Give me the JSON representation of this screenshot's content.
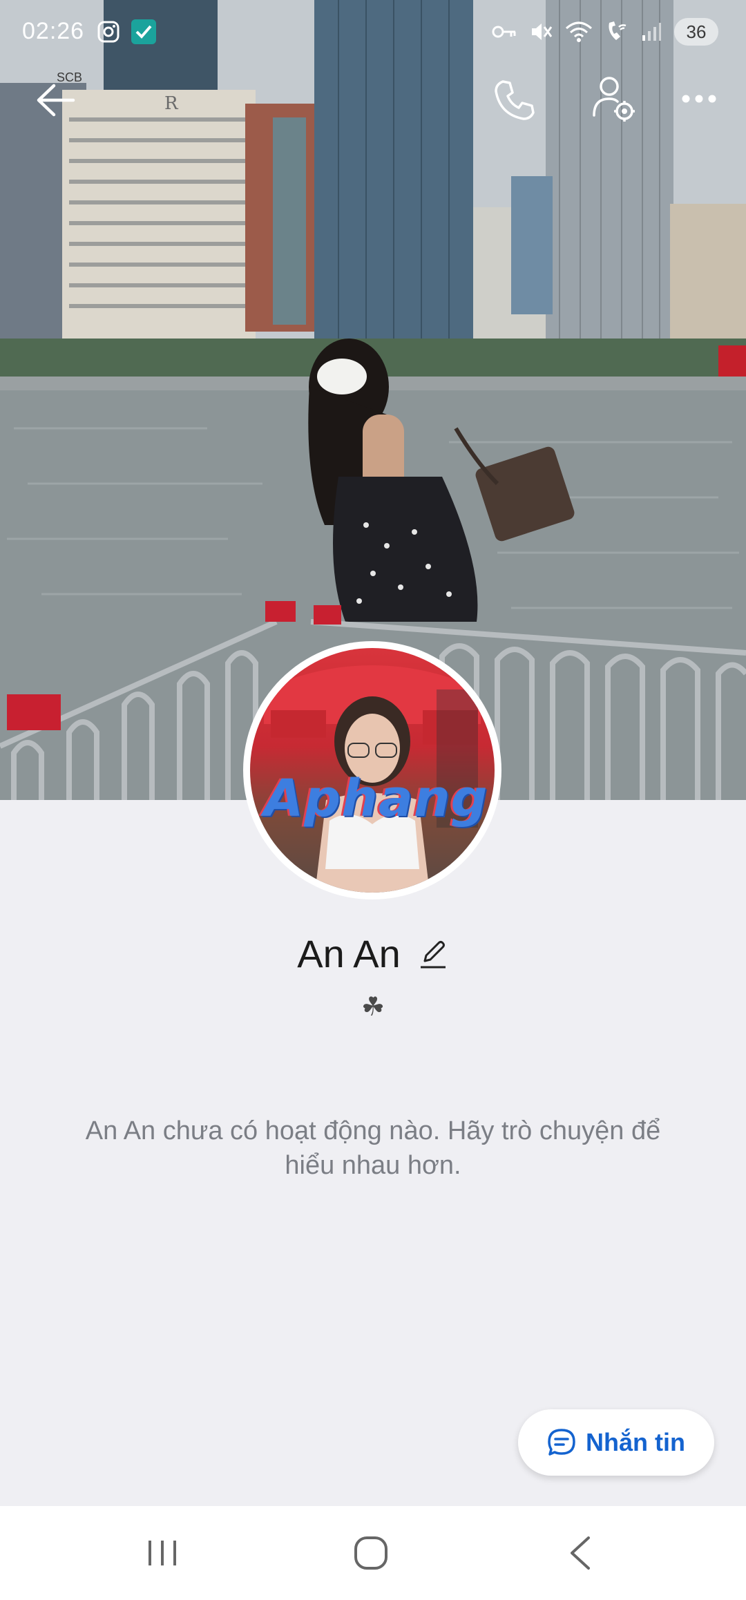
{
  "status_bar": {
    "time": "02:26",
    "battery": "36"
  },
  "cover": {
    "sign_text": "SCB",
    "hotel_letter": "R"
  },
  "profile": {
    "name": "An An",
    "status_emoji": "☘",
    "avatar_watermark": "Aphang"
  },
  "feed": {
    "empty_message": "An An chưa có hoạt động nào. Hãy trò chuyện để hiểu nhau hơn."
  },
  "actions": {
    "message_label": "Nhắn tin"
  },
  "colors": {
    "accent": "#1463cf",
    "background": "#efeff3",
    "text_primary": "#1b1b1b",
    "text_secondary": "#7b7e85"
  },
  "icons": {
    "back": "back-arrow-icon",
    "call": "phone-icon",
    "settings": "user-settings-icon",
    "more": "more-dots-icon",
    "edit": "pencil-icon",
    "message": "chat-bubble-icon"
  }
}
